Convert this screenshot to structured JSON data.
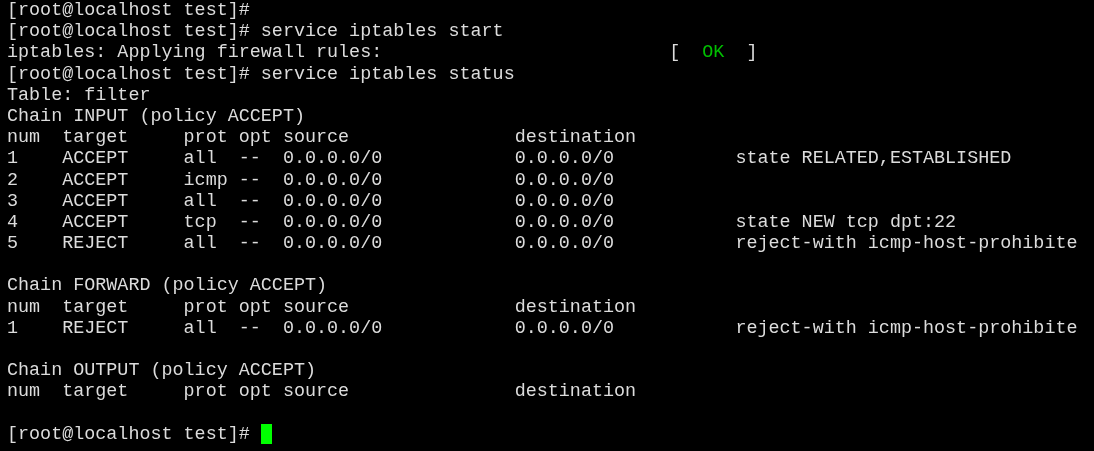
{
  "terminal": {
    "lines": [
      {
        "kind": "text",
        "text": "[root@localhost test]#"
      },
      {
        "kind": "text",
        "text": "[root@localhost test]# service iptables start"
      },
      {
        "kind": "status",
        "text": "iptables: Applying firewall rules:",
        "open": "[",
        "status": "OK",
        "close": "]"
      },
      {
        "kind": "text",
        "text": "[root@localhost test]# service iptables status"
      },
      {
        "kind": "text",
        "text": "Table: filter"
      },
      {
        "kind": "text",
        "text": "Chain INPUT (policy ACCEPT)"
      },
      {
        "kind": "text",
        "text": "num  target     prot opt source               destination"
      },
      {
        "kind": "text",
        "text": "1    ACCEPT     all  --  0.0.0.0/0            0.0.0.0/0           state RELATED,ESTABLISHED"
      },
      {
        "kind": "text",
        "text": "2    ACCEPT     icmp --  0.0.0.0/0            0.0.0.0/0"
      },
      {
        "kind": "text",
        "text": "3    ACCEPT     all  --  0.0.0.0/0            0.0.0.0/0"
      },
      {
        "kind": "text",
        "text": "4    ACCEPT     tcp  --  0.0.0.0/0            0.0.0.0/0           state NEW tcp dpt:22"
      },
      {
        "kind": "text",
        "text": "5    REJECT     all  --  0.0.0.0/0            0.0.0.0/0           reject-with icmp-host-prohibite"
      },
      {
        "kind": "blank"
      },
      {
        "kind": "text",
        "text": "Chain FORWARD (policy ACCEPT)"
      },
      {
        "kind": "text",
        "text": "num  target     prot opt source               destination"
      },
      {
        "kind": "text",
        "text": "1    REJECT     all  --  0.0.0.0/0            0.0.0.0/0           reject-with icmp-host-prohibite"
      },
      {
        "kind": "blank"
      },
      {
        "kind": "text",
        "text": "Chain OUTPUT (policy ACCEPT)"
      },
      {
        "kind": "text",
        "text": "num  target     prot opt source               destination"
      },
      {
        "kind": "blank"
      },
      {
        "kind": "prompt",
        "text": "[root@localhost test]#"
      }
    ]
  }
}
